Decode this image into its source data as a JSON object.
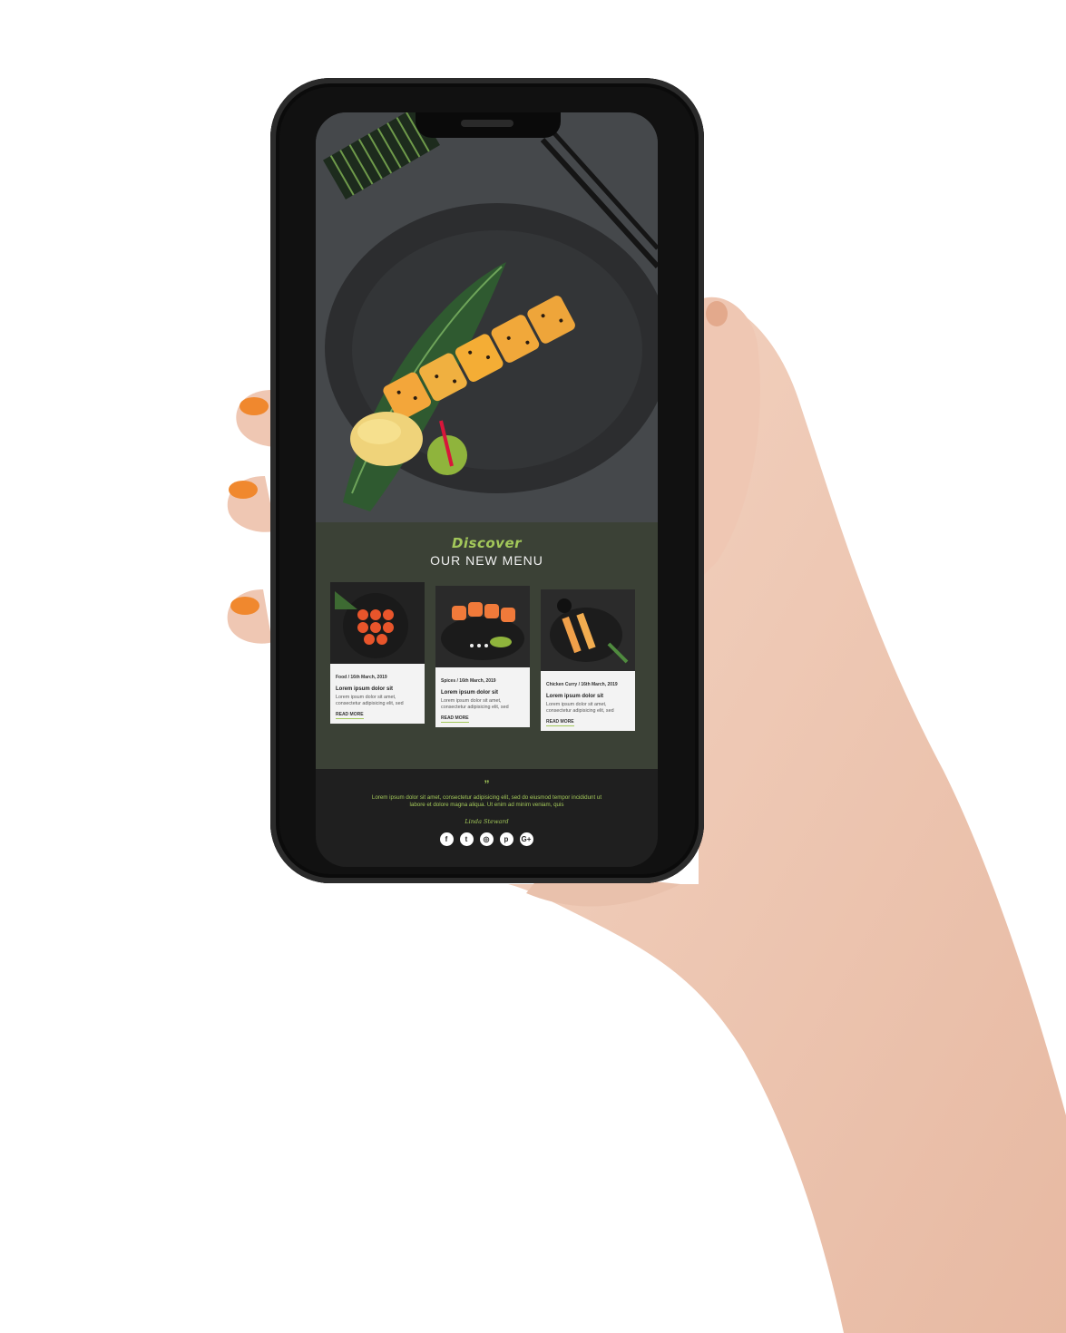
{
  "colors": {
    "accent": "#a3c85a",
    "menu_bg": "#3b4136",
    "footer_bg": "#1f1f1f",
    "card_bg": "#f3f3f3"
  },
  "menu": {
    "discover": "Discover",
    "title": "OUR NEW MENU",
    "cards": [
      {
        "meta": "Food / 16th March, 2019",
        "title": "Lorem ipsum dolor sit",
        "body": "Lorem ipsum dolor sit amet, consectetur adipisicing elit, sed",
        "read_more": "READ MORE"
      },
      {
        "meta": "Spices / 16th March, 2019",
        "title": "Lorem ipsum dolor sit",
        "body": "Lorem ipsum dolor sit amet, consectetur adipisicing elit, sed",
        "read_more": "READ MORE"
      },
      {
        "meta": "Chicken Curry / 16th March, 2019",
        "title": "Lorem ipsum dolor sit",
        "body": "Lorem ipsum dolor sit amet, consectetur adipisicing elit, sed",
        "read_more": "READ MORE"
      }
    ]
  },
  "footer": {
    "quote_mark": "”",
    "text": "Lorem ipsum dolor sit amet, consectetur adipisicing elit, sed do eiusmod tempor incididunt ut labore et dolore magna aliqua. Ut enim ad minim veniam, quis",
    "signature": "Linda Steward",
    "socials": [
      {
        "icon": "facebook-icon",
        "glyph": "f"
      },
      {
        "icon": "twitter-icon",
        "glyph": "t"
      },
      {
        "icon": "instagram-icon",
        "glyph": "◎"
      },
      {
        "icon": "pinterest-icon",
        "glyph": "p"
      },
      {
        "icon": "google-plus-icon",
        "glyph": "G+"
      }
    ]
  }
}
